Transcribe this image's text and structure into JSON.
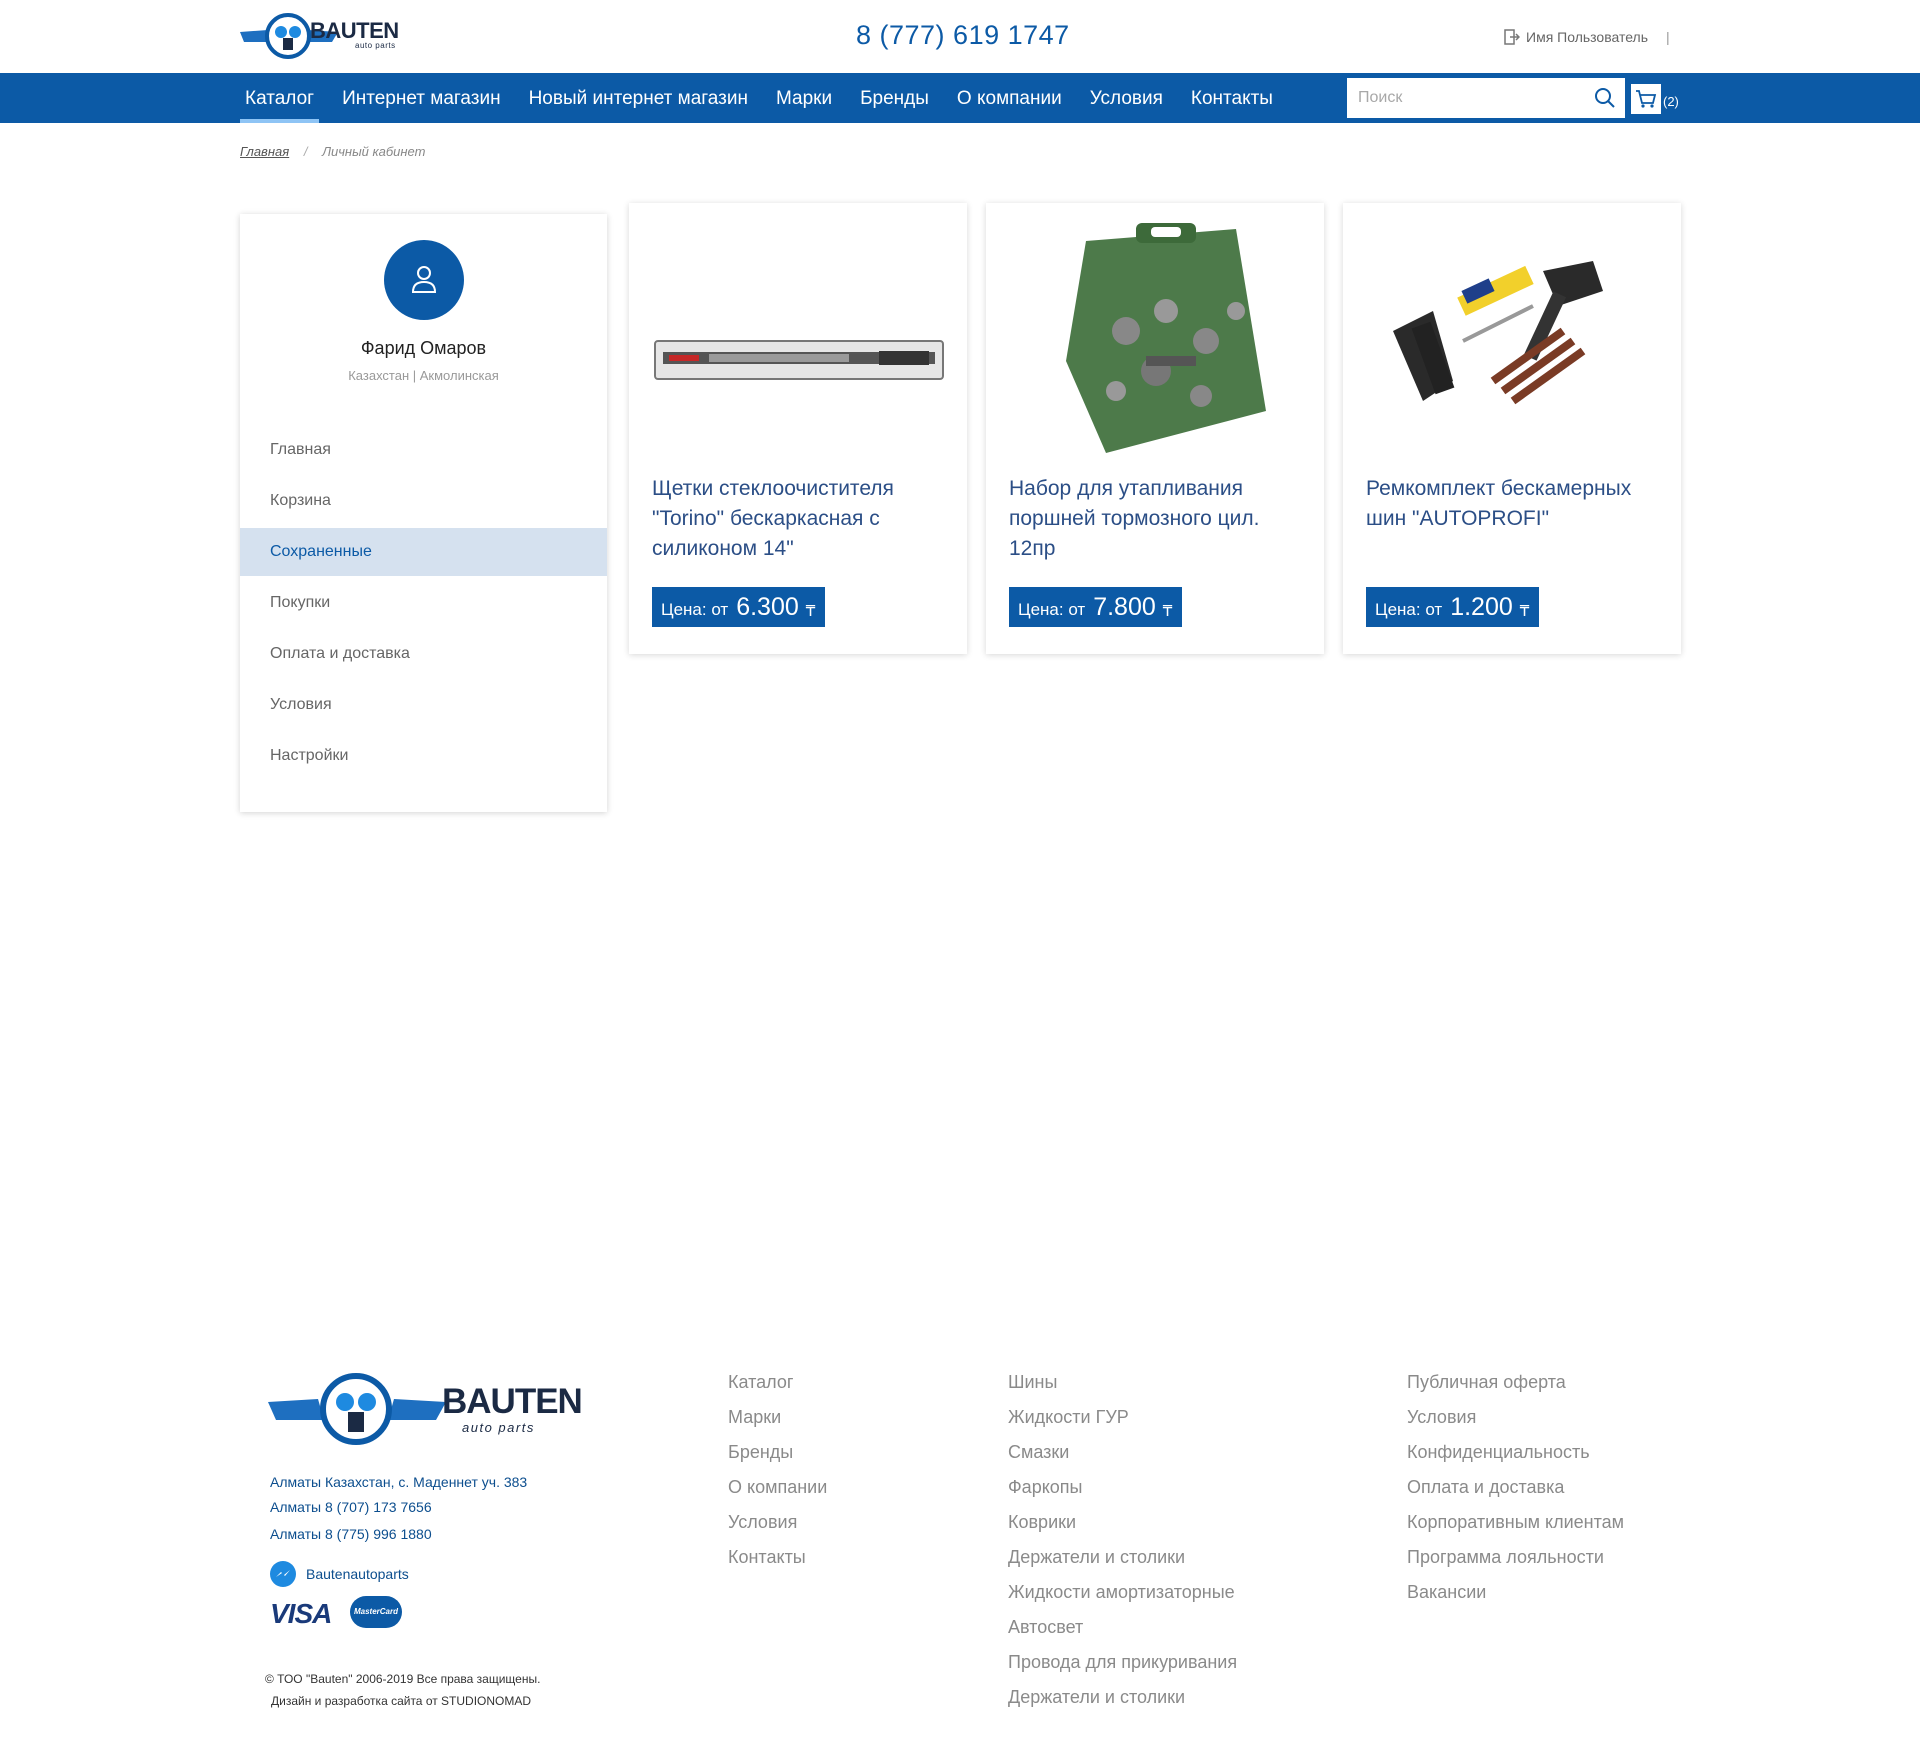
{
  "header": {
    "logo": {
      "brand": "BAUTEN",
      "tagline": "auto parts"
    },
    "phone": "8 (777) 619 1747",
    "login_label": "Имя Пользователь",
    "login_sep": "|"
  },
  "nav": {
    "items": [
      {
        "label": "Каталог",
        "active": true
      },
      {
        "label": "Интернет магазин"
      },
      {
        "label": "Новый интернет магазин"
      },
      {
        "label": "Марки"
      },
      {
        "label": "Бренды"
      },
      {
        "label": "О компании"
      },
      {
        "label": "Условия"
      },
      {
        "label": "Контакты"
      }
    ],
    "search_placeholder": "Поиск",
    "cart_count": "(2)"
  },
  "breadcrumb": {
    "home": "Главная",
    "separator": "/",
    "current": "Личный кабинет"
  },
  "profile": {
    "name": "Фарид  Омаров",
    "location": "Казахстан | Акмолинская",
    "menu": [
      {
        "label": "Главная"
      },
      {
        "label": "Корзина"
      },
      {
        "label": "Сохраненные",
        "active": true
      },
      {
        "label": "Покупки"
      },
      {
        "label": "Оплата и доставка"
      },
      {
        "label": "Условия"
      },
      {
        "label": "Настройки"
      }
    ]
  },
  "products": [
    {
      "title": "Щетки стеклоочистителя \"Torino\" бескаркасная с силиконом 14\"",
      "price_label": "Цена: от",
      "price": "6.300",
      "currency": "₸",
      "image_icon": "wiper-blade-image"
    },
    {
      "title": "Набор для утапливания поршней тормозного цил. 12пр",
      "price_label": "Цена: от",
      "price": "7.800",
      "currency": "₸",
      "image_icon": "brake-tool-case-image"
    },
    {
      "title": "Ремкомплект бескамерных шин \"AUTOPROFI\"",
      "price_label": "Цена: от",
      "price": "1.200",
      "currency": "₸",
      "image_icon": "tire-repair-kit-image"
    }
  ],
  "footer": {
    "logo": {
      "brand": "BAUTEN",
      "tagline": "auto parts"
    },
    "address": "Алматы Казахстан, с. Маденнет уч. 383",
    "phone1": "Алматы  8 (707) 173 7656",
    "phone2": "Алматы 8 (775) 996 1880",
    "messenger": "Bautenautoparts",
    "visa": "VISA",
    "mastercard": "MasterCard",
    "copyright": "© ТОО \"Bauten\" 2006-2019 Все права защищены.",
    "developer": "Дизайн и разработка сайта от  STUDIONOMAD",
    "col1": [
      "Каталог",
      "Марки",
      "Бренды",
      "О компании",
      "Условия",
      "Контакты"
    ],
    "col2": [
      "Шины",
      "Жидкости ГУР",
      "Смазки",
      "Фаркопы",
      "Коврики",
      "Держатели и столики",
      "Жидкости амортизаторные",
      "Автосвет",
      "Провода для прикуривания",
      "Держатели и столики"
    ],
    "col3": [
      "Публичная оферта",
      "Условия",
      "Конфиденциальность",
      "Оплата и доставка",
      "Корпоративным клиентам",
      "Программа лояльности",
      "Вакансии"
    ]
  },
  "colors": {
    "primary": "#0c5aa6",
    "title": "#2b4e86",
    "active_bg": "#d5e1ef",
    "footer_link": "#8a8a8a"
  }
}
